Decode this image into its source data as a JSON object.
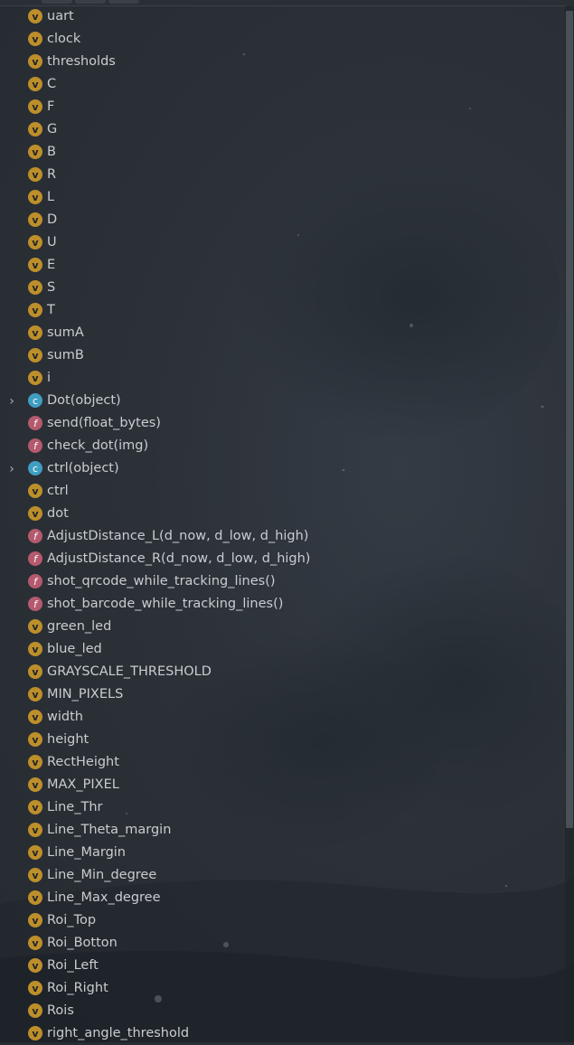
{
  "tree": {
    "items": [
      {
        "kind": "v",
        "label": "uart"
      },
      {
        "kind": "v",
        "label": "clock"
      },
      {
        "kind": "v",
        "label": "thresholds"
      },
      {
        "kind": "v",
        "label": "C"
      },
      {
        "kind": "v",
        "label": "F"
      },
      {
        "kind": "v",
        "label": "G"
      },
      {
        "kind": "v",
        "label": "B"
      },
      {
        "kind": "v",
        "label": "R"
      },
      {
        "kind": "v",
        "label": "L"
      },
      {
        "kind": "v",
        "label": "D"
      },
      {
        "kind": "v",
        "label": "U"
      },
      {
        "kind": "v",
        "label": "E"
      },
      {
        "kind": "v",
        "label": "S"
      },
      {
        "kind": "v",
        "label": "T"
      },
      {
        "kind": "v",
        "label": "sumA"
      },
      {
        "kind": "v",
        "label": "sumB"
      },
      {
        "kind": "v",
        "label": "i"
      },
      {
        "kind": "c",
        "label": "Dot(object)",
        "expandable": true
      },
      {
        "kind": "f",
        "label": "send(float_bytes)"
      },
      {
        "kind": "f",
        "label": "check_dot(img)"
      },
      {
        "kind": "c",
        "label": "ctrl(object)",
        "expandable": true
      },
      {
        "kind": "v",
        "label": "ctrl"
      },
      {
        "kind": "v",
        "label": "dot"
      },
      {
        "kind": "f",
        "label": "AdjustDistance_L(d_now, d_low, d_high)"
      },
      {
        "kind": "f",
        "label": "AdjustDistance_R(d_now, d_low, d_high)"
      },
      {
        "kind": "f",
        "label": "shot_qrcode_while_tracking_lines()"
      },
      {
        "kind": "f",
        "label": "shot_barcode_while_tracking_lines()"
      },
      {
        "kind": "v",
        "label": "green_led"
      },
      {
        "kind": "v",
        "label": "blue_led"
      },
      {
        "kind": "v",
        "label": "GRAYSCALE_THRESHOLD"
      },
      {
        "kind": "v",
        "label": "MIN_PIXELS"
      },
      {
        "kind": "v",
        "label": "width"
      },
      {
        "kind": "v",
        "label": "height"
      },
      {
        "kind": "v",
        "label": "RectHeight"
      },
      {
        "kind": "v",
        "label": "MAX_PIXEL"
      },
      {
        "kind": "v",
        "label": "Line_Thr"
      },
      {
        "kind": "v",
        "label": "Line_Theta_margin"
      },
      {
        "kind": "v",
        "label": "Line_Margin"
      },
      {
        "kind": "v",
        "label": "Line_Min_degree"
      },
      {
        "kind": "v",
        "label": "Line_Max_degree"
      },
      {
        "kind": "v",
        "label": "Roi_Top"
      },
      {
        "kind": "v",
        "label": "Roi_Botton"
      },
      {
        "kind": "v",
        "label": "Roi_Left"
      },
      {
        "kind": "v",
        "label": "Roi_Right"
      },
      {
        "kind": "v",
        "label": "Rois"
      },
      {
        "kind": "v",
        "label": "right_angle_threshold"
      }
    ]
  },
  "badges": {
    "v": "v",
    "f": "f",
    "c": "c"
  },
  "expand_glyph": "›",
  "colors": {
    "variable": "#bd8f2a",
    "function": "#b55a6e",
    "class": "#3f9ec2",
    "text": "#c9cdd1"
  }
}
